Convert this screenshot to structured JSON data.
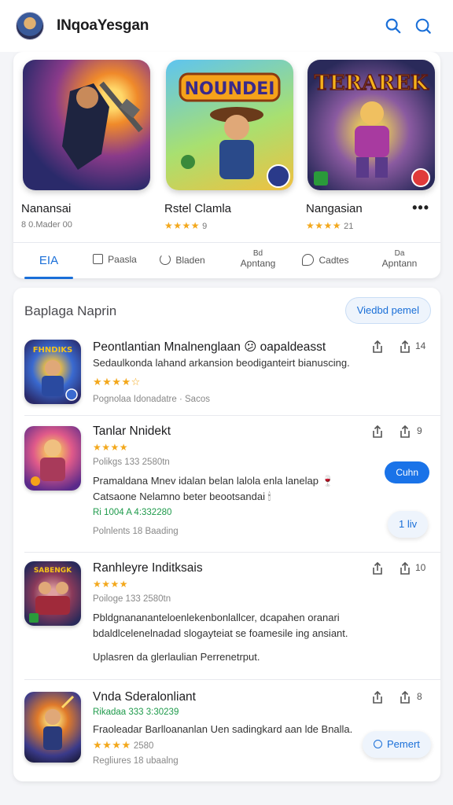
{
  "header": {
    "title": "INqoaYesgan",
    "icons": [
      "search-icon",
      "search-icon-alt"
    ]
  },
  "featured": {
    "games": [
      {
        "name": "Nanansai",
        "sub": "8 0.Mader 00",
        "stars": "",
        "art_title": ""
      },
      {
        "name": "Rstel Clamla",
        "sub": "9",
        "stars": "★★★★",
        "art_title": "NOUNDEI"
      },
      {
        "name": "Nangasian",
        "sub": "21",
        "stars": "★★★★",
        "art_title": "TERAREK"
      }
    ],
    "more": "•••"
  },
  "tabs": [
    {
      "label": "EIA",
      "icon": "",
      "active": true
    },
    {
      "label": "Paasla",
      "icon": "page-icon",
      "active": false
    },
    {
      "label": "Bladen",
      "icon": "refresh-icon",
      "active": false
    },
    {
      "label": "Apntang",
      "icon_text": "Bd",
      "active": false
    },
    {
      "label": "Cadtes",
      "icon": "chat-icon",
      "active": false
    },
    {
      "label": "Apntann",
      "icon_text": "Da",
      "active": false
    }
  ],
  "list": {
    "title": "Baplaga Naprin",
    "view_button": "Viedbd pemel",
    "items": [
      {
        "title": "Peontlantian Mnalnenglaan 😕 oapaldeasst",
        "desc1": "Sedaulkonda lahand arkansion beodiganteirt bianuscing.",
        "stars": "★★★★☆",
        "meta": "Pognolaa Idonadatre · Sacos",
        "count": "14",
        "art_title": "FHNDIKS"
      },
      {
        "title": "Tanlar Nnidekt",
        "stars": "★★★★",
        "sub": "Polikgs 133 2580tn",
        "desc1": "Pramaldana Mnev idalan belan lalola enla lanelap 🍷",
        "desc2": "Catsaone Nelamno beter beootsandai 🕯",
        "green": "Ri 1004 A 4:332280",
        "meta": "Polnlents 18 Baading",
        "count": "9",
        "button": "Cuhn",
        "pill": "1 liv"
      },
      {
        "title": "Ranhleyre Inditksais",
        "stars": "★★★★",
        "sub": "Poiloge 133 2580tn",
        "desc1": "Pbldgnanananteloenlekenbonlallcer, dcapahen oranari",
        "desc2": "bdaldlcelenelnadad slogayteiat se foamesile ing ansiant.",
        "desc3": "Uplasren da glerlaulian Perrenetrput.",
        "count": "10",
        "art_title": "SABENGK"
      },
      {
        "title": "Vnda Sderalonliant",
        "green": "Rikadaa 333 3:30239",
        "desc1": "Fraoleadar Barlloananlan Uen sadingkard aan lde Bnalla.",
        "stars": "★★★★",
        "stars_suffix": "2580",
        "meta": "Regliures 18 ubaalng",
        "count": "8",
        "pill": "Pemert"
      }
    ]
  },
  "colors": {
    "accent": "#1a73e8",
    "star": "#f3a81c",
    "green": "#1e9a4b"
  }
}
